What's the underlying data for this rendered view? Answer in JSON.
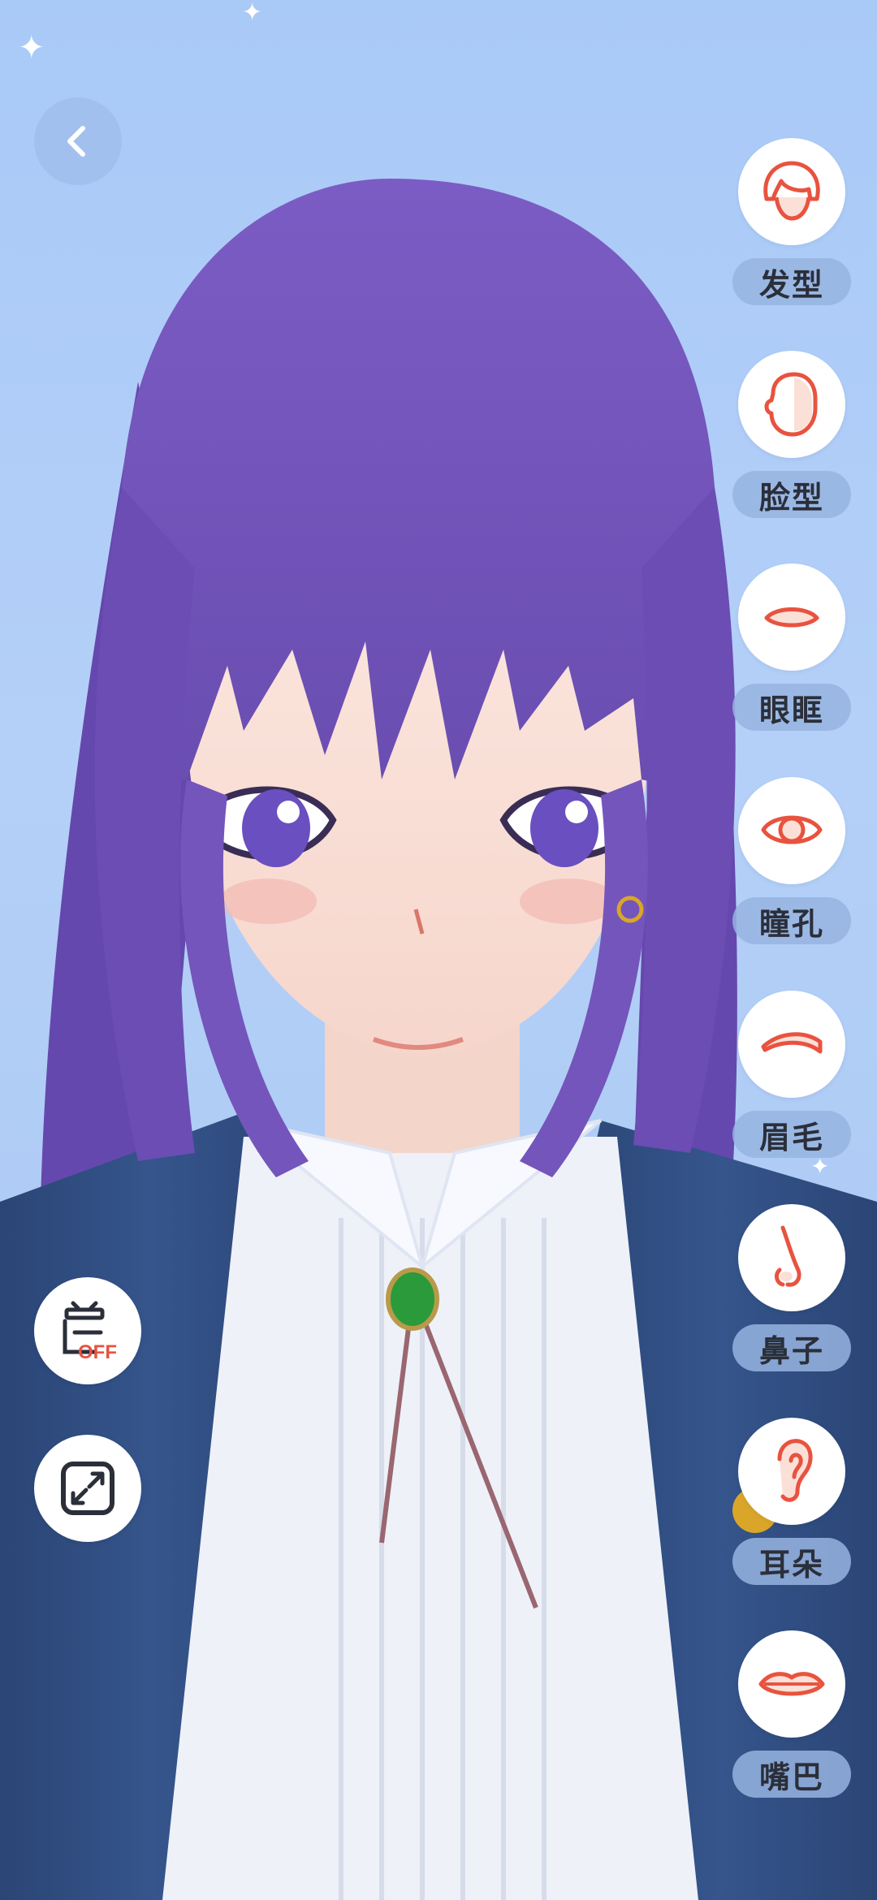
{
  "nav": {
    "back_icon": "chevron-left-icon"
  },
  "tools": {
    "stage_toggle": {
      "icon": "stage-icon",
      "badge": "OFF"
    },
    "expand": {
      "icon": "expand-arrows-icon"
    }
  },
  "face_parts": [
    {
      "label": "发型",
      "icon": "hair-icon"
    },
    {
      "label": "脸型",
      "icon": "face-shape-icon"
    },
    {
      "label": "眼眶",
      "icon": "eye-socket-icon"
    },
    {
      "label": "瞳孔",
      "icon": "pupil-icon"
    },
    {
      "label": "眉毛",
      "icon": "eyebrow-icon"
    },
    {
      "label": "鼻子",
      "icon": "nose-icon"
    },
    {
      "label": "耳朵",
      "icon": "ear-icon"
    },
    {
      "label": "嘴巴",
      "icon": "mouth-icon"
    }
  ],
  "colors": {
    "accent": "#e8533f",
    "label_bg": "#96b4e1",
    "background": "#abc9f6",
    "hair": "#7050b8",
    "jacket": "#2e4a7d"
  }
}
